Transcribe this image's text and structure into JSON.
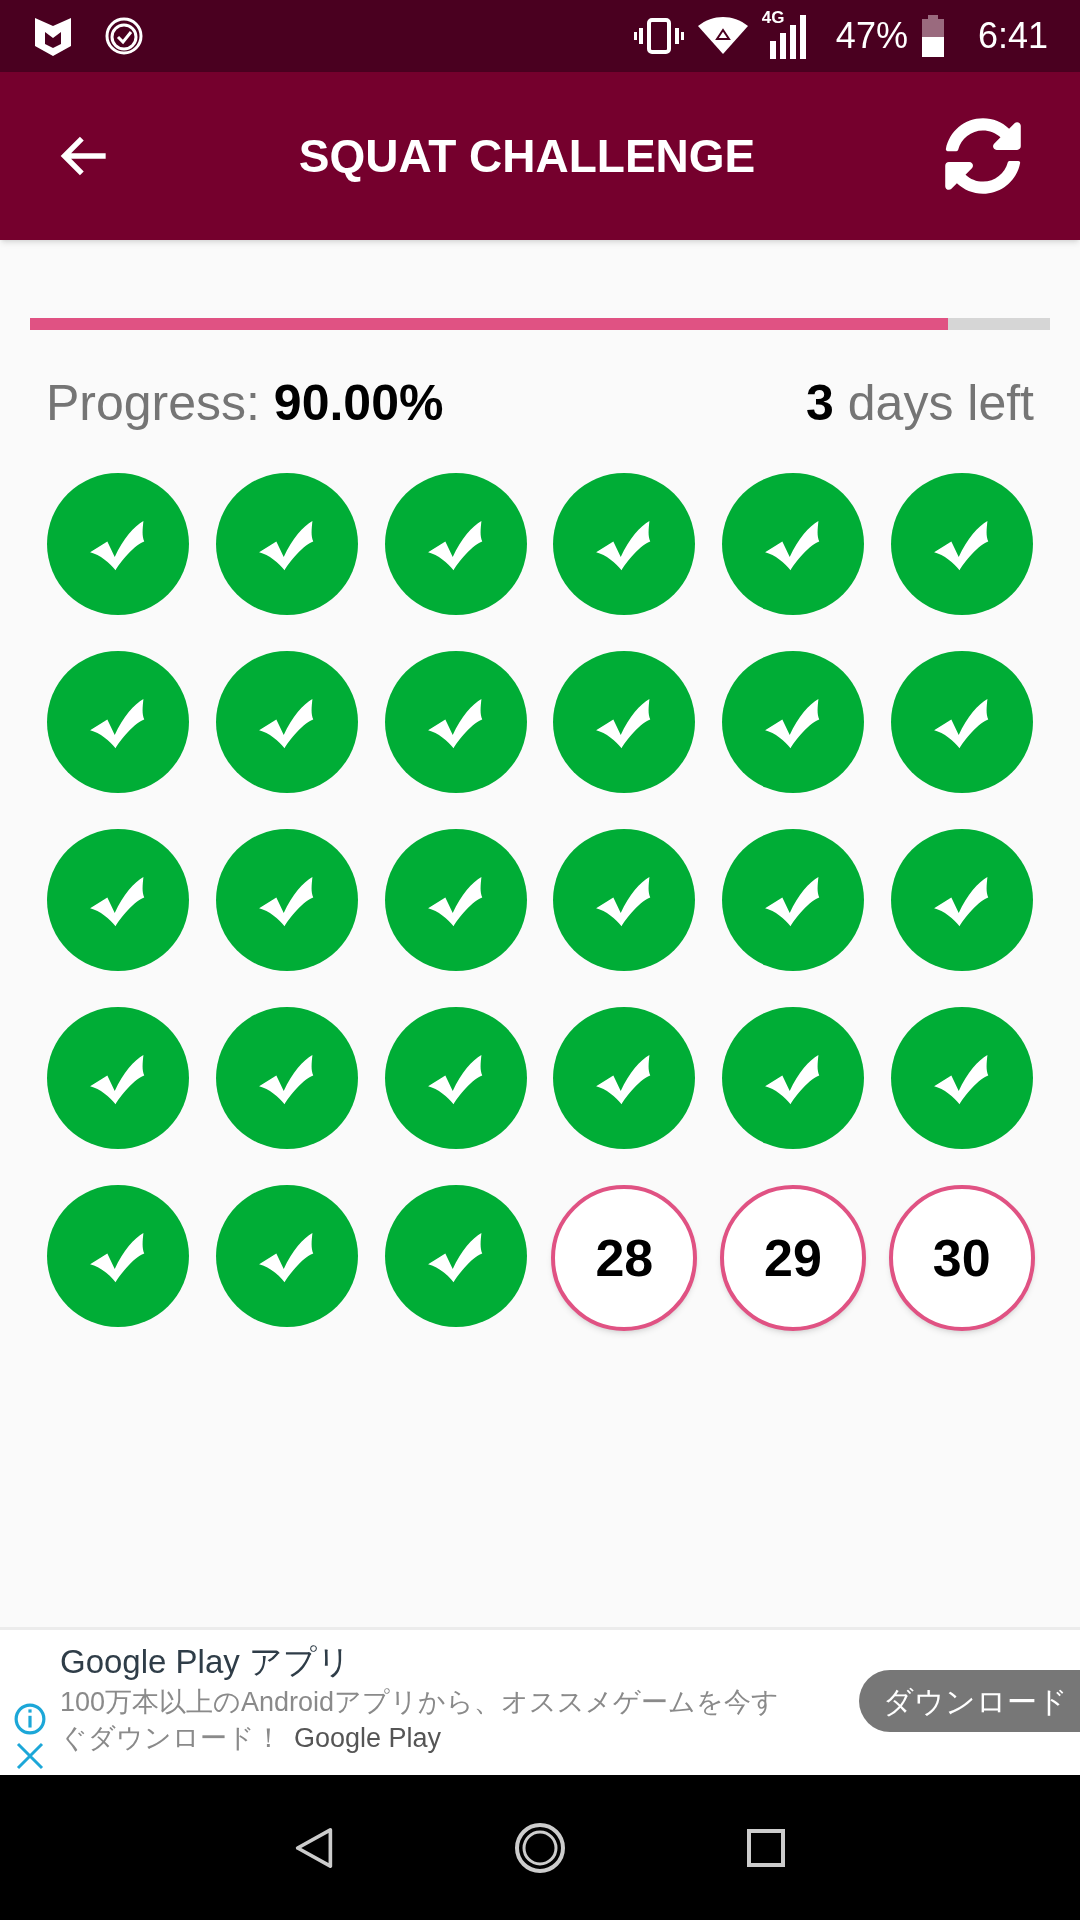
{
  "status_bar": {
    "network": "4G",
    "battery": "47%",
    "time": "6:41"
  },
  "app_bar": {
    "title": "SQUAT CHALLENGE"
  },
  "progress": {
    "level": 0.9,
    "label": "Progress: **90.00%**",
    "remaining": "**3** days left"
  },
  "days": [
    {
      "checked": true
    },
    {
      "checked": true
    },
    {
      "checked": true
    },
    {
      "checked": true
    },
    {
      "checked": true
    },
    {
      "checked": true
    },
    {
      "checked": true
    },
    {
      "checked": true
    },
    {
      "checked": true
    },
    {
      "checked": true
    },
    {
      "checked": true
    },
    {
      "checked": true
    },
    {
      "checked": true
    },
    {
      "checked": true
    },
    {
      "checked": true
    },
    {
      "checked": true
    },
    {
      "checked": true
    },
    {
      "checked": true
    },
    {
      "checked": true
    },
    {
      "checked": true
    },
    {
      "checked": true
    },
    {
      "checked": true
    },
    {
      "checked": true
    },
    {
      "checked": true
    },
    {
      "checked": true
    },
    {
      "checked": true
    },
    {
      "checked": true
    },
    {
      "checked": false,
      "label": "28"
    },
    {
      "checked": false,
      "label": "29"
    },
    {
      "checked": false,
      "label": "30"
    }
  ],
  "ad": {
    "title": "Google Play アプリ",
    "body_lines": [
      "100万本以上のAndroidアプリから、オススメゲームを今す",
      "ぐダウンロード！"
    ],
    "source": "Google Play",
    "button": "ダウンロード"
  }
}
